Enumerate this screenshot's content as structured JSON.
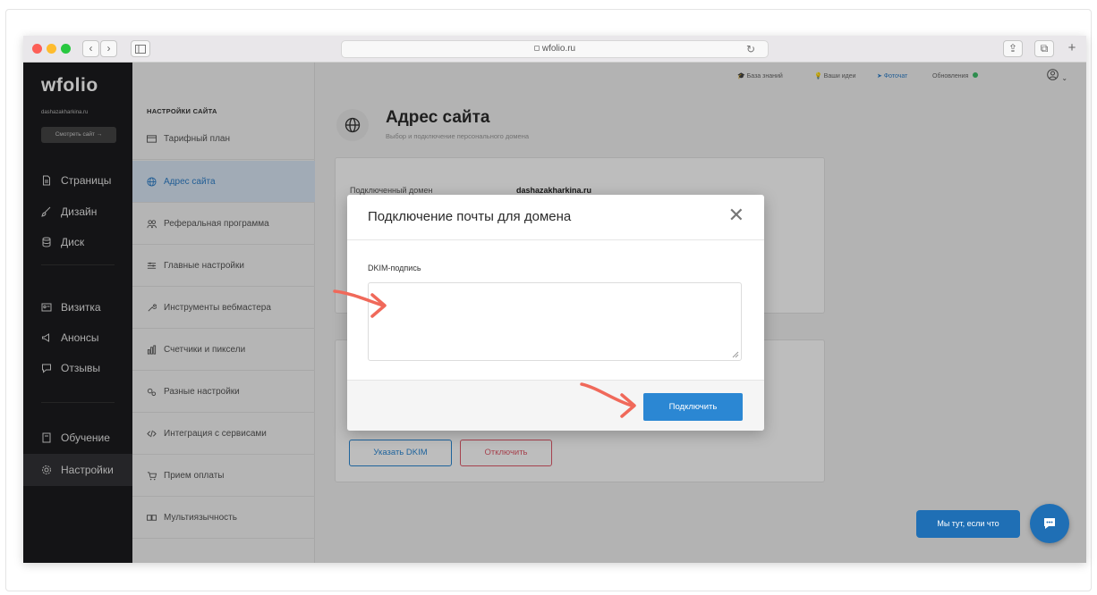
{
  "browser": {
    "url": "wfolio.ru",
    "reload_glyph": "↻",
    "back_glyph": "‹",
    "forward_glyph": "›",
    "share_glyph": "⇪",
    "tabs_glyph": "⧉",
    "new_tab_glyph": "+"
  },
  "leftnav": {
    "logo": "wfolio",
    "site_domain": "dashazakharkina.ru",
    "view_site": "Смотреть сайт →",
    "items": [
      {
        "label": "Страницы",
        "icon": "file-icon"
      },
      {
        "label": "Дизайн",
        "icon": "brush-icon"
      },
      {
        "label": "Диск",
        "icon": "database-icon"
      },
      {
        "label": "Визитка",
        "icon": "card-icon"
      },
      {
        "label": "Анонсы",
        "icon": "megaphone-icon"
      },
      {
        "label": "Отзывы",
        "icon": "chat-icon"
      },
      {
        "label": "Обучение",
        "icon": "book-icon"
      },
      {
        "label": "Настройки",
        "icon": "gear-icon"
      }
    ]
  },
  "settings": {
    "title": "НАСТРОЙКИ САЙТА",
    "items": [
      {
        "label": "Тарифный план"
      },
      {
        "label": "Адрес сайта"
      },
      {
        "label": "Реферальная программа"
      },
      {
        "label": "Главные настройки"
      },
      {
        "label": "Инструменты вебмастера"
      },
      {
        "label": "Счетчики и пиксели"
      },
      {
        "label": "Разные настройки"
      },
      {
        "label": "Интеграция с сервисами"
      },
      {
        "label": "Прием оплаты"
      },
      {
        "label": "Мультиязычность"
      }
    ]
  },
  "topbar": {
    "knowledge": "База знаний",
    "ideas": "Ваши идеи",
    "photochat": "Фоточат",
    "updates": "Обновления"
  },
  "page": {
    "title": "Адрес сайта",
    "subtitle": "Выбор и подключение персонального домена",
    "connected_label": "Подключенный домен",
    "connected_value": "dashazakharkina.ru",
    "dkim_button": "Указать DKIM",
    "disconnect_button": "Отключить"
  },
  "modal": {
    "title": "Подключение почты для домена",
    "close_glyph": "✕",
    "field_label": "DKIM-подпись",
    "dkim_value": "",
    "connect_button": "Подключить"
  },
  "chat": {
    "label": "Мы тут, если что"
  },
  "colors": {
    "accent": "#2b87d3",
    "nav_bg": "#1c1c1e",
    "active_setting_bg": "#d9e7f6",
    "danger": "#e05a6a",
    "arrow": "#f0695a",
    "online": "#3fbf6a"
  }
}
